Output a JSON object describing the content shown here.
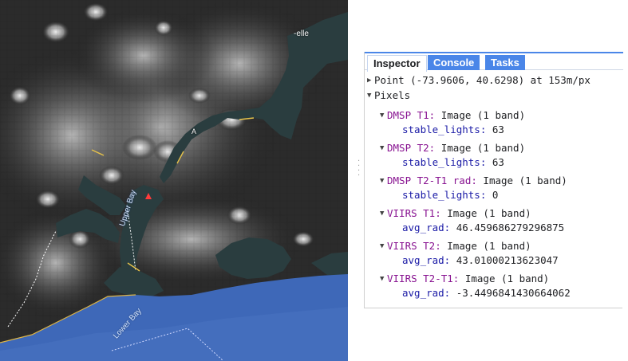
{
  "inspector": {
    "tabs": [
      {
        "label": "Inspector",
        "active": true
      },
      {
        "label": "Console",
        "active": false
      },
      {
        "label": "Tasks",
        "active": false
      }
    ],
    "point_line": "Point (-73.9606, 40.6298) at 153m/px",
    "pixels_label": "Pixels",
    "layers": [
      {
        "name": "DMSP T1:",
        "desc": "Image (1 band)",
        "band": "stable_lights:",
        "value": "63"
      },
      {
        "name": "DMSP T2:",
        "desc": "Image (1 band)",
        "band": "stable_lights:",
        "value": "63"
      },
      {
        "name": "DMSP T2-T1 rad:",
        "desc": "Image (1 band)",
        "band": "stable_lights:",
        "value": "0"
      },
      {
        "name": "VIIRS T1:",
        "desc": "Image (1 band)",
        "band": "avg_rad:",
        "value": "46.459686279296875"
      },
      {
        "name": "VIIRS T2:",
        "desc": "Image (1 band)",
        "band": "avg_rad:",
        "value": "43.01000213623047"
      },
      {
        "name": "VIIRS T2-T1:",
        "desc": "Image (1 band)",
        "band": "avg_rad:",
        "value": "-3.4496841430664062"
      }
    ],
    "colors": {
      "tab_blue": "#4a86e8",
      "key_purple": "#881391",
      "prop_blue": "#1a1aa6"
    }
  },
  "map": {
    "labels": [
      "Upper Bay",
      "Lower Bay",
      "-elle",
      "A"
    ],
    "colors": {
      "water": "#2a3d3f",
      "ocean": "#3e68b8",
      "land": "#1e1e1e"
    }
  }
}
